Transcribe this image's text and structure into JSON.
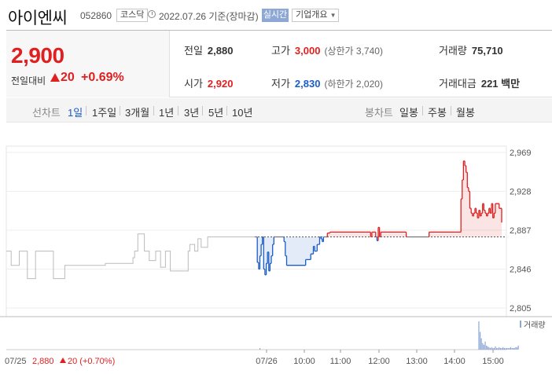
{
  "header": {
    "name": "아이엔씨",
    "code": "052860",
    "market": "코스닥",
    "date": "2022.07.26 기준(장마감)",
    "status": "실시간",
    "overview": "기업개요"
  },
  "quote": {
    "price": "2,900",
    "change_label": "전일대비",
    "change": "20",
    "change_pct": "+0.69%",
    "prev_label": "전일",
    "prev": "2,880",
    "open_label": "시가",
    "open": "2,920",
    "high_label": "고가",
    "high": "3,000",
    "upper_limit": "(상한가 3,740)",
    "low_label": "저가",
    "low": "2,830",
    "lower_limit": "(하한가 2,020)",
    "volume_label": "거래량",
    "volume": "75,710",
    "amount_label": "거래대금",
    "amount": "221 백만"
  },
  "periods": {
    "title": "선차트",
    "items": [
      "1일",
      "1주일",
      "3개월",
      "1년",
      "3년",
      "5년",
      "10년"
    ],
    "active": "1일",
    "candle_title": "봉차트",
    "candle_items": [
      "일봉",
      "주봉",
      "월봉"
    ]
  },
  "colors": {
    "up": "#e02020",
    "down": "#1a5cc8",
    "prev": "#bbbbbb",
    "accent": "#8ea8d6"
  },
  "chart_data": {
    "type": "line",
    "yticks": [
      2969,
      2928,
      2887,
      2846,
      2805
    ],
    "ytick_labels": [
      "2,969",
      "2,928",
      "2,887",
      "2,846",
      "2,805"
    ],
    "ylim": [
      2805,
      2969
    ],
    "baseline": 2880,
    "xticks": [
      "07/26",
      "10:00",
      "11:00",
      "12:00",
      "13:00",
      "14:00",
      "15:00"
    ],
    "volume_label": "거래량",
    "footer": {
      "date": "07/25",
      "price": "2,880",
      "change": "20 (+0.70%)"
    },
    "prev_day_series": [
      2865,
      2865,
      2865,
      2850,
      2850,
      2850,
      2850,
      2850,
      2865,
      2865,
      2865,
      2865,
      2865,
      2836,
      2836,
      2836,
      2836,
      2836,
      2865,
      2865,
      2865,
      2865,
      2865,
      2865,
      2865,
      2865,
      2865,
      2865,
      2865,
      2836,
      2836,
      2836,
      2836,
      2836,
      2836,
      2836,
      2850,
      2850,
      2850,
      2850,
      2850,
      2850,
      2850,
      2850,
      2850,
      2850,
      2850,
      2850,
      2850,
      2850,
      2850,
      2850,
      2850,
      2850,
      2850,
      2850,
      2850,
      2850,
      2850,
      2850,
      2850,
      2852,
      2852,
      2852,
      2852,
      2852,
      2852,
      2852,
      2852,
      2852,
      2852,
      2852,
      2852,
      2852,
      2852,
      2852,
      2852,
      2852,
      2858,
      2865,
      2865,
      2883,
      2883,
      2883,
      2883,
      2865,
      2865,
      2865,
      2855,
      2855,
      2855,
      2855,
      2865,
      2865,
      2865,
      2848,
      2848,
      2848,
      2865,
      2865,
      2865,
      2844,
      2844,
      2844,
      2844,
      2844,
      2844,
      2844,
      2844,
      2844,
      2844,
      2844,
      2865,
      2872,
      2872,
      2872,
      2865,
      2865,
      2878,
      2878,
      2869,
      2869,
      2869,
      2869,
      2880,
      2880,
      2880,
      2880,
      2880,
      2880,
      2880,
      2880,
      2880,
      2880,
      2880,
      2880,
      2880,
      2880,
      2880,
      2880,
      2880,
      2880,
      2880,
      2880,
      2880,
      2880,
      2880,
      2880,
      2880,
      2880,
      2880,
      2880,
      2880,
      2880
    ],
    "today_series": [
      2880,
      2880,
      2853,
      2846,
      2860,
      2872,
      2880,
      2846,
      2840,
      2852,
      2864,
      2844,
      2852,
      2860,
      2872,
      2880,
      2880,
      2880,
      2880,
      2880,
      2880,
      2880,
      2880,
      2875,
      2860,
      2850,
      2850,
      2850,
      2850,
      2850,
      2850,
      2850,
      2850,
      2850,
      2850,
      2850,
      2850,
      2850,
      2850,
      2850,
      2856,
      2856,
      2856,
      2856,
      2862,
      2862,
      2870,
      2865,
      2865,
      2872,
      2872,
      2880,
      2878,
      2875,
      2880,
      2880,
      2880,
      2884,
      2884,
      2885,
      2885,
      2885,
      2885,
      2885,
      2885,
      2885,
      2885,
      2885,
      2885,
      2885,
      2885,
      2885,
      2885,
      2885,
      2885,
      2885,
      2885,
      2885,
      2885,
      2885,
      2885,
      2885,
      2885,
      2885,
      2885,
      2885,
      2885,
      2885,
      2885,
      2885,
      2885,
      2880,
      2885,
      2885,
      2885,
      2880,
      2876,
      2890,
      2880,
      2885,
      2885,
      2885,
      2885,
      2885,
      2885,
      2885,
      2885,
      2885,
      2885,
      2885,
      2885,
      2885,
      2885,
      2885,
      2885,
      2885,
      2885,
      2885,
      2885,
      2880,
      2880,
      2880,
      2880,
      2880,
      2880,
      2880,
      2880,
      2880,
      2880,
      2880,
      2880,
      2880,
      2880,
      2880,
      2880,
      2880,
      2880,
      2885,
      2885,
      2885,
      2885,
      2885,
      2885,
      2885,
      2885,
      2885,
      2885,
      2885,
      2885,
      2885,
      2885,
      2885,
      2885,
      2885,
      2885,
      2885,
      2885,
      2885,
      2885,
      2885,
      2885,
      2885,
      2920,
      2940,
      2960,
      2955,
      2948,
      2932,
      2928,
      2910,
      2905,
      2902,
      2905,
      2910,
      2905,
      2900,
      2908,
      2902,
      2905,
      2915,
      2908,
      2905,
      2902,
      2905,
      2910,
      2905,
      2915,
      2900,
      2905,
      2915,
      2915,
      2915,
      2910,
      2910,
      2895
    ],
    "volumes": [
      0,
      0,
      0,
      0,
      2,
      0,
      0,
      0,
      0,
      0,
      0,
      0,
      0,
      0,
      0,
      0,
      0,
      0,
      0,
      0,
      0,
      0,
      0,
      0,
      0,
      0,
      0,
      0,
      0,
      0,
      0,
      0,
      0,
      0,
      0,
      0,
      0,
      0,
      0,
      0,
      0,
      0,
      0,
      0,
      0,
      0,
      0,
      0,
      0,
      0,
      0,
      0,
      0,
      0,
      0,
      0,
      0,
      0,
      0,
      0,
      0,
      0,
      0,
      0,
      0,
      0,
      0,
      0,
      0,
      0,
      0,
      0,
      0,
      0,
      0,
      0,
      0,
      0,
      0,
      0,
      0,
      0,
      0,
      0,
      0,
      0,
      0,
      0,
      0,
      0,
      0,
      0,
      0,
      0,
      0,
      0,
      0,
      0,
      0,
      0,
      0,
      0,
      0,
      0,
      0,
      0,
      0,
      0,
      0,
      0,
      0,
      0,
      0,
      0,
      0,
      0,
      0,
      0,
      0,
      0,
      0,
      0,
      0,
      0,
      0,
      0,
      0,
      0,
      0,
      0,
      0,
      0,
      0,
      0,
      0,
      0,
      0,
      0,
      0,
      0,
      0,
      0,
      0,
      0,
      0,
      0,
      0,
      0,
      0,
      0,
      0,
      0,
      0,
      0,
      0,
      0,
      0,
      0,
      0,
      0,
      0,
      0,
      0,
      0,
      0,
      0,
      0,
      0,
      0,
      0,
      0,
      0,
      0,
      0,
      0,
      0,
      35,
      22,
      14,
      8,
      6,
      10,
      5,
      4,
      3,
      2,
      3,
      2,
      2,
      4,
      2,
      2,
      3,
      2,
      2,
      3,
      2,
      2,
      2,
      2,
      2,
      3,
      2,
      2,
      2,
      3,
      3,
      5
    ]
  }
}
